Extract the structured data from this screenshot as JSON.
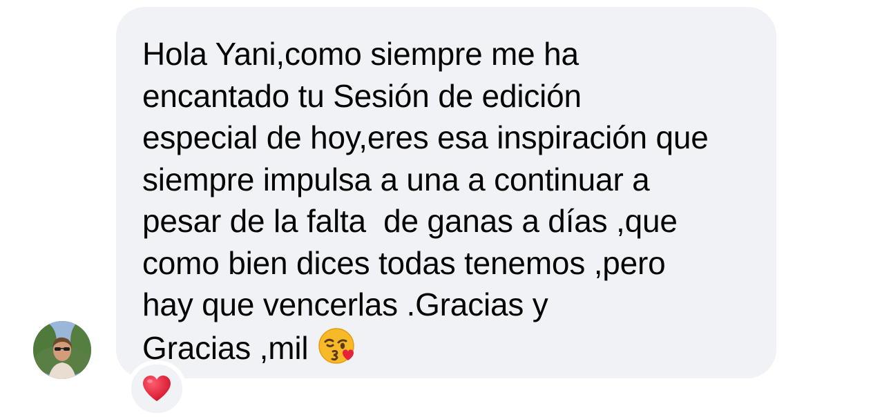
{
  "conversation": {
    "avatar_icon": "user-avatar-photo",
    "message": {
      "lines": [
        "Hola Yani,como siempre me ha",
        "encantado tu Sesión de edición",
        "especial de hoy,eres esa inspiración que",
        "siempre impulsa a una a continuar a",
        "pesar de la falta  de ganas a días ,que",
        "como bien dices todas tenemos ,pero",
        "hay que vencerlas .Gracias y",
        "Gracias ,mil"
      ],
      "emoji_icon": "face-blowing-kiss-icon"
    },
    "reaction": {
      "icon": "red-heart-icon",
      "color": "#e5243b"
    },
    "colors": {
      "bubble_background": "#f1f2f6",
      "text": "#050505"
    }
  }
}
